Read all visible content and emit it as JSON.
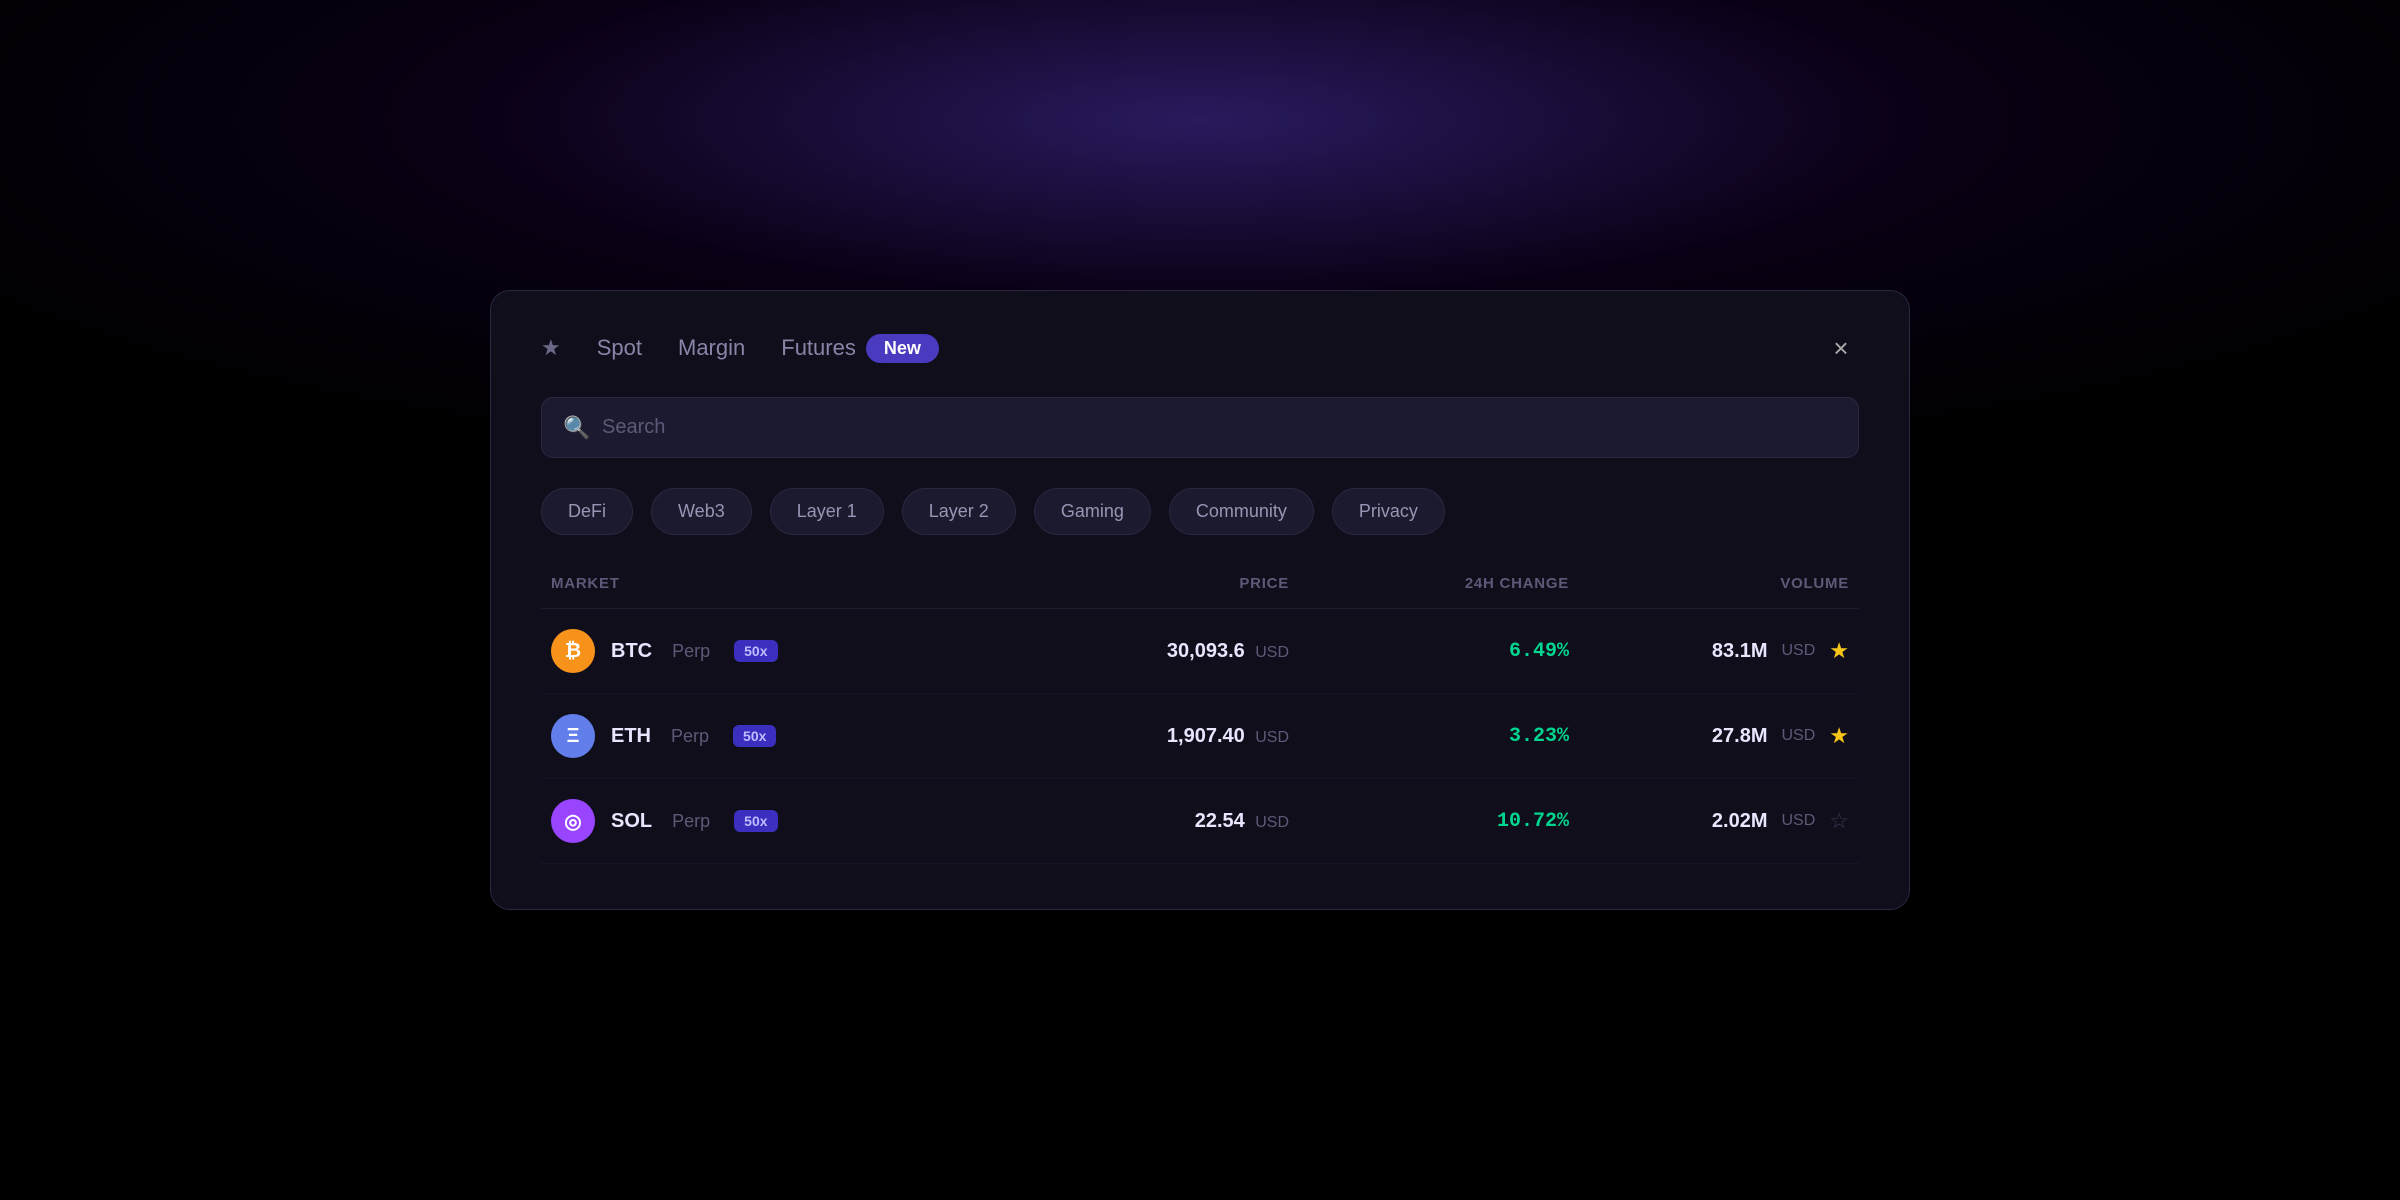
{
  "background": {
    "glow_color": "#2a1a5e"
  },
  "modal": {
    "tabs": [
      {
        "id": "spot",
        "label": "Spot"
      },
      {
        "id": "margin",
        "label": "Margin"
      },
      {
        "id": "futures",
        "label": "Futures"
      }
    ],
    "futures_badge": "New",
    "close_label": "×",
    "search_placeholder": "Search",
    "categories": [
      {
        "id": "defi",
        "label": "DeFi"
      },
      {
        "id": "web3",
        "label": "Web3"
      },
      {
        "id": "layer1",
        "label": "Layer 1"
      },
      {
        "id": "layer2",
        "label": "Layer 2"
      },
      {
        "id": "gaming",
        "label": "Gaming"
      },
      {
        "id": "community",
        "label": "Community"
      },
      {
        "id": "privacy",
        "label": "Privacy"
      }
    ],
    "table": {
      "headers": {
        "market": "MARKET",
        "price": "Price",
        "change": "24H Change",
        "volume": "Volume"
      },
      "rows": [
        {
          "symbol": "BTC",
          "type": "Perp",
          "leverage": "50x",
          "icon_letter": "₿",
          "icon_class": "coin-btc",
          "price": "30,093.6",
          "price_unit": "USD",
          "change": "6.49%",
          "volume": "83.1M",
          "volume_unit": "USD",
          "starred": true
        },
        {
          "symbol": "ETH",
          "type": "Perp",
          "leverage": "50x",
          "icon_letter": "Ξ",
          "icon_class": "coin-eth",
          "price": "1,907.40",
          "price_unit": "USD",
          "change": "3.23%",
          "volume": "27.8M",
          "volume_unit": "USD",
          "starred": true
        },
        {
          "symbol": "SOL",
          "type": "Perp",
          "leverage": "50x",
          "icon_letter": "◎",
          "icon_class": "coin-sol",
          "price": "22.54",
          "price_unit": "USD",
          "change": "10.72%",
          "volume": "2.02M",
          "volume_unit": "USD",
          "starred": false
        }
      ]
    }
  }
}
